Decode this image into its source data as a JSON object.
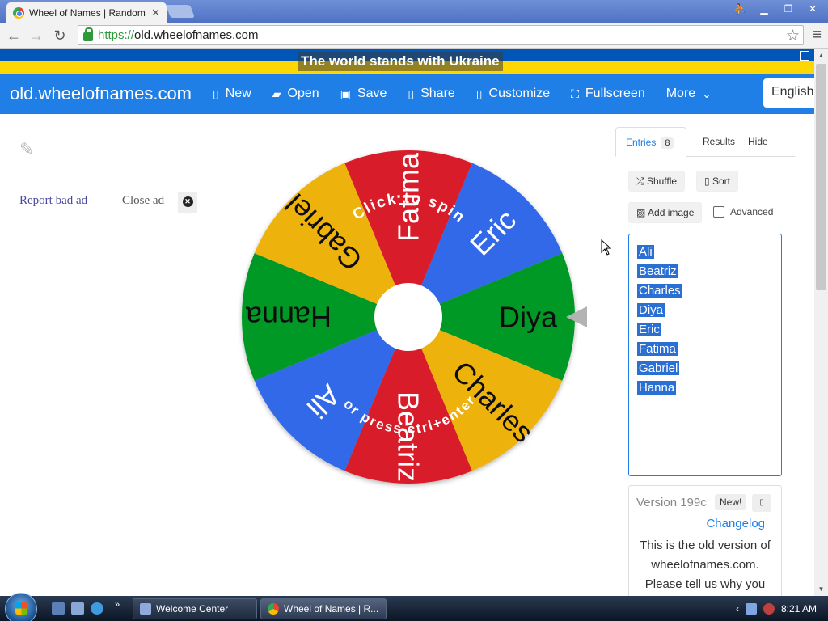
{
  "browser": {
    "tab_title": "Wheel of Names | Random",
    "url_scheme": "https://",
    "url_host": "old.wheelofnames.com"
  },
  "banner": {
    "text": "The world stands with Ukraine"
  },
  "navbar": {
    "brand": "old.wheelofnames.com",
    "items": [
      {
        "label": "New",
        "icon": "file-icon"
      },
      {
        "label": "Open",
        "icon": "folder-open-icon"
      },
      {
        "label": "Save",
        "icon": "floppy-disk-icon"
      },
      {
        "label": "Share",
        "icon": "share-icon"
      },
      {
        "label": "Customize",
        "icon": "palette-icon"
      },
      {
        "label": "Fullscreen",
        "icon": "fullscreen-icon"
      },
      {
        "label": "More",
        "icon": "chevron-down-icon"
      }
    ],
    "language": "English"
  },
  "ad": {
    "report": "Report bad ad",
    "close": "Close ad"
  },
  "wheel": {
    "top_text": "Click to spin",
    "bottom_text": "or press ctrl+enter",
    "segments": [
      {
        "name": "Fatima",
        "color": "#d91a2a"
      },
      {
        "name": "Eric",
        "color": "#3369e8"
      },
      {
        "name": "Diya",
        "color": "#009925"
      },
      {
        "name": "Charles",
        "color": "#eeb211"
      },
      {
        "name": "Beatriz",
        "color": "#d91a2a"
      },
      {
        "name": "Ali",
        "color": "#3369e8"
      },
      {
        "name": "Hanna",
        "color": "#009925"
      },
      {
        "name": "Gabriel",
        "color": "#eeb211"
      }
    ]
  },
  "panel": {
    "tabs": {
      "entries": "Entries",
      "entries_count": "8",
      "results": "Results",
      "hide": "Hide"
    },
    "shuffle": "Shuffle",
    "sort": "Sort",
    "add_image": "Add image",
    "advanced": "Advanced",
    "entries": [
      "Ali",
      "Beatriz",
      "Charles",
      "Diya",
      "Eric",
      "Fatima",
      "Gabriel",
      "Hanna"
    ],
    "version": "Version 199c",
    "new_badge": "New!",
    "changelog": "Changelog",
    "version_text": [
      "This is the old version of",
      "wheelofnames.com.",
      "Please tell us why you"
    ]
  },
  "taskbar": {
    "buttons": [
      "Welcome Center",
      "Wheel of Names | R..."
    ],
    "time": "8:21 AM"
  }
}
